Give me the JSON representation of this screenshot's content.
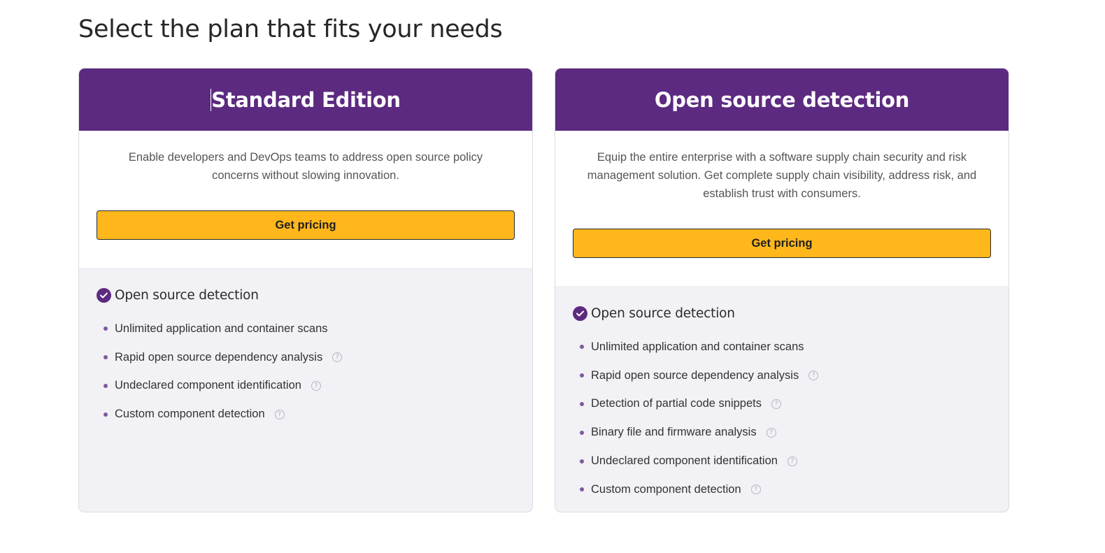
{
  "page": {
    "title": "Select the plan that fits your needs"
  },
  "colors": {
    "header_purple": "#5c2a80",
    "button_yellow": "#ffb71b",
    "panel_gray": "#f2f1f5"
  },
  "plans": [
    {
      "title": "Standard Edition",
      "description": "Enable developers and DevOps teams to address open source policy concerns without slowing innovation.",
      "button_label": "Get pricing",
      "feature_group": "Open source detection",
      "features": [
        {
          "label": "Unlimited application and container scans",
          "has_help": false
        },
        {
          "label": "Rapid open source dependency analysis",
          "has_help": true
        },
        {
          "label": "Undeclared component identification",
          "has_help": true
        },
        {
          "label": "Custom component detection",
          "has_help": true
        }
      ]
    },
    {
      "title": "Open source detection",
      "description": "Equip the entire enterprise with a software supply chain security and risk management solution. Get complete supply chain visibility, address risk, and establish trust with consumers.",
      "button_label": "Get pricing",
      "feature_group": "Open source detection",
      "features": [
        {
          "label": "Unlimited application and container scans",
          "has_help": false
        },
        {
          "label": "Rapid open source dependency analysis",
          "has_help": true
        },
        {
          "label": "Detection of partial code snippets",
          "has_help": true
        },
        {
          "label": "Binary file and firmware analysis",
          "has_help": true
        },
        {
          "label": "Undeclared component identification",
          "has_help": true
        },
        {
          "label": "Custom component detection",
          "has_help": true
        }
      ]
    }
  ],
  "icons": {
    "check": "check-circle-icon",
    "help": "question-circle-icon",
    "help_glyph": "?"
  }
}
